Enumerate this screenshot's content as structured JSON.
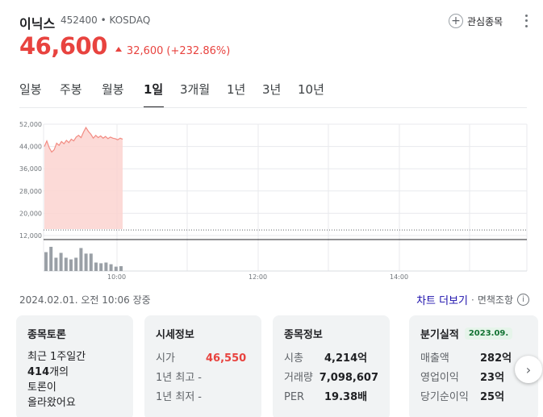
{
  "stock": {
    "name": "이닉스",
    "code_exchange": "452400 • KOSDAQ",
    "price": "46,600",
    "change": "32,600",
    "change_pct": "(+232.86%)",
    "color_up": "#e8433f"
  },
  "header": {
    "watch_label": "관심종목"
  },
  "tabs": [
    {
      "label": "일봉",
      "active": false
    },
    {
      "label": "주봉",
      "active": false
    },
    {
      "label": "월봉",
      "active": false
    },
    {
      "label": "1일",
      "active": true
    },
    {
      "label": "3개월",
      "active": false
    },
    {
      "label": "1년",
      "active": false
    },
    {
      "label": "3년",
      "active": false
    },
    {
      "label": "10년",
      "active": false
    }
  ],
  "meta": {
    "datetime": "2024.02.01. 오전 10:06 장중",
    "chart_more": "차트 더보기",
    "disclaimer": "면책조항",
    "info_icon": "i"
  },
  "chart_data": {
    "type": "area",
    "y_ticks": [
      "52,000",
      "44,000",
      "36,000",
      "28,000",
      "20,000",
      "12,000"
    ],
    "y_tick_values": [
      52000,
      44000,
      36000,
      28000,
      20000,
      12000
    ],
    "ylim": [
      12000,
      52000
    ],
    "x_ticks": [
      "10:00",
      "12:00",
      "14:00"
    ],
    "prev_close": 14000,
    "series": [
      {
        "values": [
          44000,
          46000,
          43500,
          42000,
          42800,
          45200,
          44400,
          45800,
          45000,
          46200,
          45400,
          46600,
          46000,
          47400,
          48000,
          47200,
          49200,
          50800,
          49400,
          48400,
          47000,
          48000,
          47200,
          47800,
          47000,
          47600,
          46800,
          47400,
          47000,
          46800,
          46400,
          47000,
          46600
        ]
      }
    ],
    "volume": [
      0.78,
      1.0,
      0.55,
      0.75,
      0.55,
      0.48,
      0.55,
      0.95,
      0.72,
      0.72,
      0.35,
      0.32,
      0.35,
      0.28,
      0.18,
      0.2
    ],
    "colors": {
      "line": "#f28b82",
      "fill": "#fbd3d0",
      "volume": "#9aa0a6",
      "grid": "#e8eaed"
    }
  },
  "cards": {
    "discussion": {
      "title": "종목토론",
      "line1": "최근 1주일간",
      "count": "414",
      "line2_suffix": "개의",
      "line3": "토론이",
      "line4": "올라왔어요"
    },
    "market": {
      "title": "시세정보",
      "rows": [
        {
          "k": "시가",
          "v": "46,550"
        },
        {
          "k": "1년 최고",
          "v": "-"
        },
        {
          "k": "1년 최저",
          "v": "-"
        }
      ]
    },
    "stockinfo": {
      "title": "종목정보",
      "rows": [
        {
          "k": "시총",
          "v": "4,214억"
        },
        {
          "k": "거래량",
          "v": "7,098,607"
        },
        {
          "k": "PER",
          "v": "19.38배"
        }
      ]
    },
    "quarterly": {
      "title": "분기실적",
      "badge": "2023.09.",
      "rows": [
        {
          "k": "매출액",
          "v": "282억"
        },
        {
          "k": "영업이익",
          "v": "23억"
        },
        {
          "k": "당기순이익",
          "v": "25억"
        }
      ]
    }
  }
}
